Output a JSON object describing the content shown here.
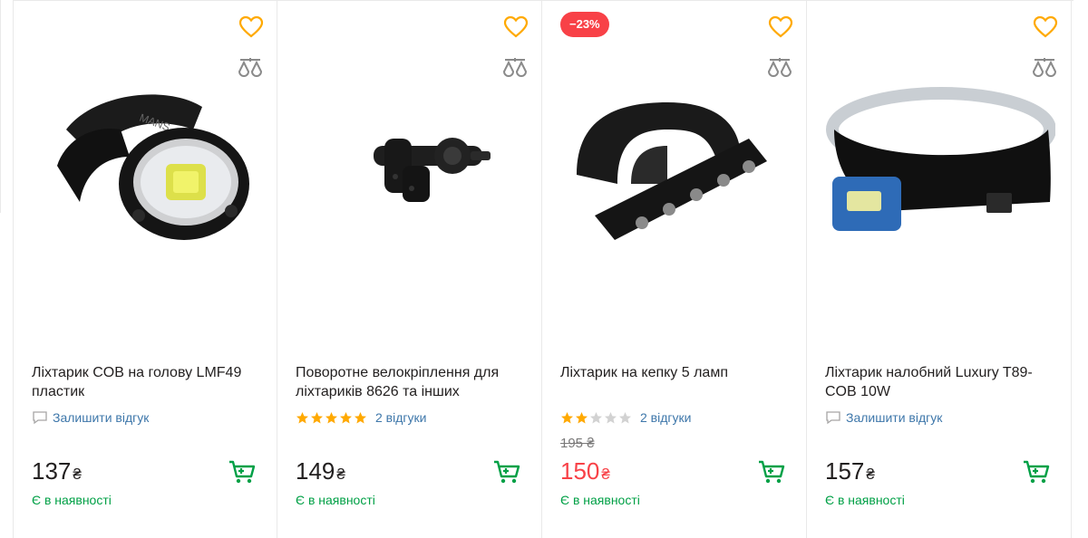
{
  "currency_symbol": "₴",
  "colors": {
    "accent_yellow": "#ffa900",
    "accent_green": "#00a046",
    "price_red": "#f84147",
    "link_blue": "#3e77aa",
    "star_gold": "#ffa900",
    "star_empty": "#d2d2d2"
  },
  "icons": {
    "favorite": "heart-icon",
    "compare": "scales-icon",
    "cart": "cart-icon",
    "review": "speech-bubble-icon",
    "rating": "star-icon"
  },
  "products": [
    {
      "title": "Ліхтарик COB на голову LMF49 пластик",
      "review_text": "Залишити відгук",
      "rating": 0,
      "price": "137",
      "old_price": "",
      "discount": "",
      "availability": "Є в наявності"
    },
    {
      "title": "Поворотне велокріплення для ліхтариків 8626 та інших",
      "review_text": "2 відгуки",
      "rating": 5,
      "price": "149",
      "old_price": "",
      "discount": "",
      "availability": "Є в наявності"
    },
    {
      "title": "Ліхтарик на кепку 5 ламп",
      "review_text": "2 відгуки",
      "rating": 2,
      "price": "150",
      "old_price": "195 ₴",
      "discount": "−23%",
      "availability": "Є в наявності"
    },
    {
      "title": "Ліхтарик налобний Luxury T89-COB 10W",
      "review_text": "Залишити відгук",
      "rating": 0,
      "price": "157",
      "old_price": "",
      "discount": "",
      "availability": "Є в наявності"
    }
  ]
}
